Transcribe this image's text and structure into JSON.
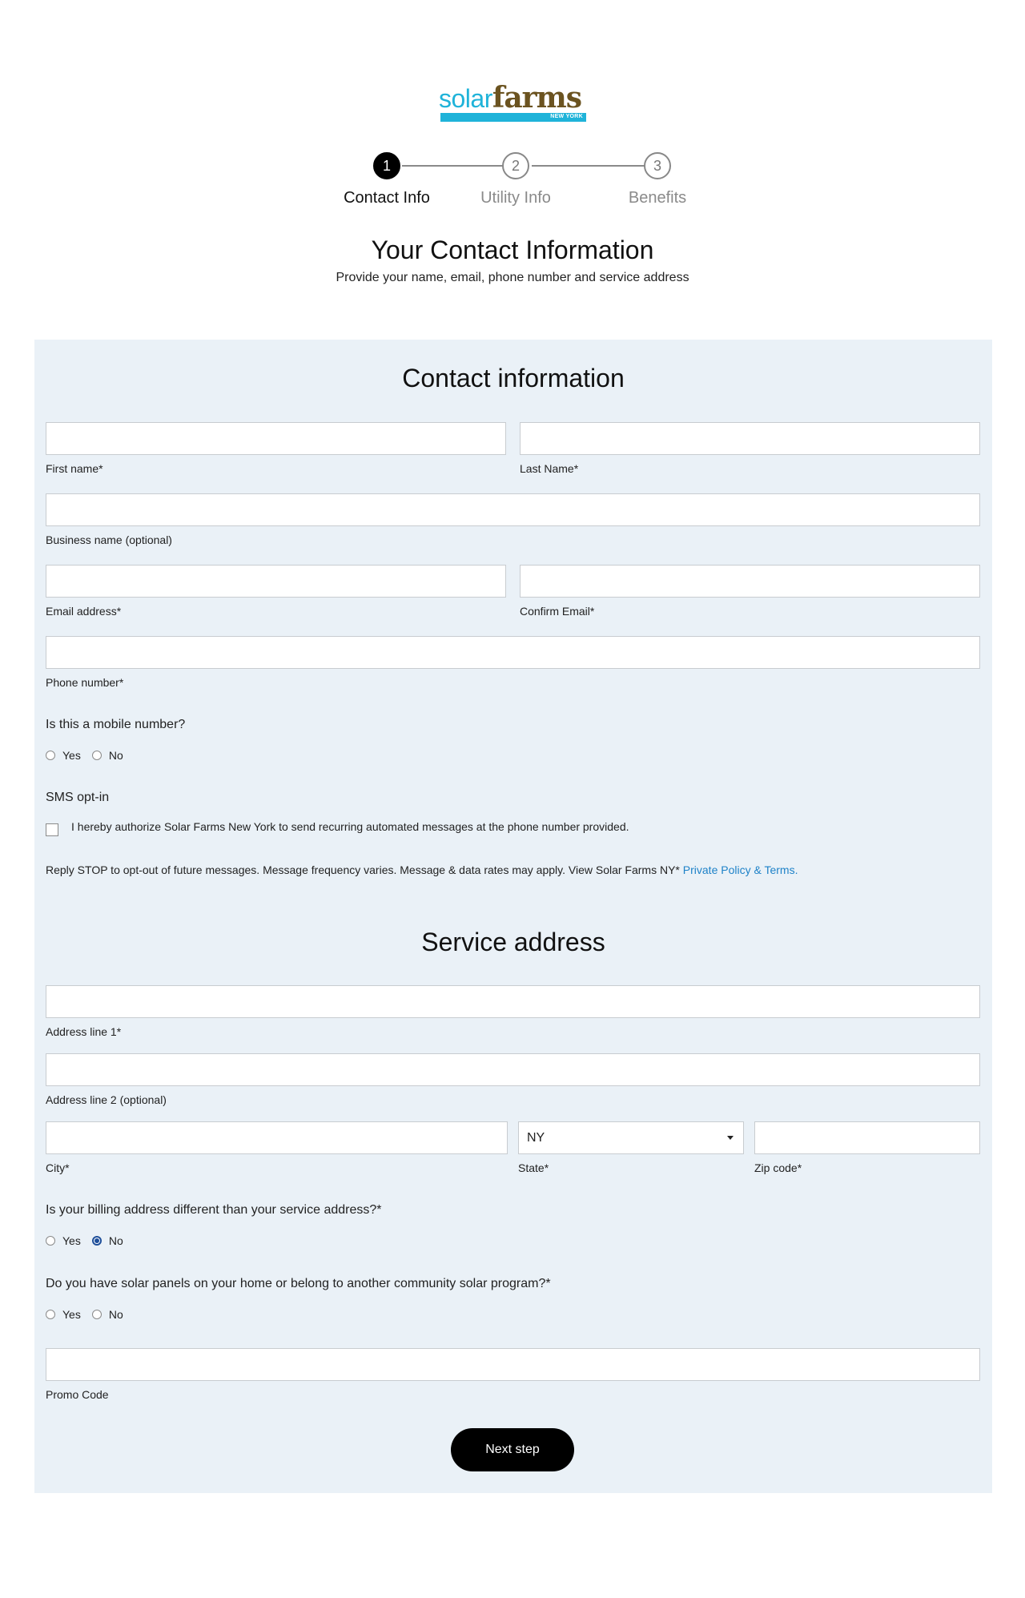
{
  "logo": {
    "word1": "solar",
    "word2": "farms",
    "tagline": "NEW YORK",
    "colors": {
      "solar": "#1fb3d9",
      "farms": "#6b5320"
    }
  },
  "stepper": {
    "steps": [
      {
        "number": "1",
        "label": "Contact Info",
        "state": "active"
      },
      {
        "number": "2",
        "label": "Utility Info",
        "state": "idle"
      },
      {
        "number": "3",
        "label": "Benefits",
        "state": "idle"
      }
    ]
  },
  "header": {
    "title": "Your Contact Information",
    "subtitle": "Provide your name, email, phone number and service address"
  },
  "contact": {
    "section_title": "Contact information",
    "first_name": {
      "label": "First name*",
      "value": ""
    },
    "last_name": {
      "label": "Last Name*",
      "value": ""
    },
    "business_name": {
      "label": "Business name (optional)",
      "value": ""
    },
    "email": {
      "label": "Email address*",
      "value": ""
    },
    "confirm_email": {
      "label": "Confirm Email*",
      "value": ""
    },
    "phone": {
      "label": "Phone number*",
      "value": ""
    },
    "mobile_question": "Is this a mobile number?",
    "mobile_options": [
      "Yes",
      "No"
    ],
    "sms_title": "SMS opt-in",
    "sms_consent": "I hereby authorize Solar Farms New York to send recurring automated messages at the phone number provided.",
    "sms_disclaimer": "Reply STOP to opt-out of future messages. Message frequency varies. Message & data rates may apply. View Solar Farms NY*",
    "sms_link": "Private Policy & Terms."
  },
  "service": {
    "section_title": "Service address",
    "address1": {
      "label": "Address line 1*",
      "value": ""
    },
    "address2": {
      "label": "Address line 2 (optional)",
      "value": ""
    },
    "city": {
      "label": "City*",
      "value": ""
    },
    "state": {
      "label": "State*",
      "value": "NY"
    },
    "zip": {
      "label": "Zip code*",
      "value": ""
    },
    "billing_question": "Is your billing address different than your service address?*",
    "billing_options": [
      "Yes",
      "No"
    ],
    "billing_selected": "No",
    "solar_question": "Do you have solar panels on your home or belong to another community solar program?*",
    "solar_options": [
      "Yes",
      "No"
    ],
    "promo": {
      "label": "Promo Code",
      "value": ""
    },
    "next_button": "Next step"
  }
}
